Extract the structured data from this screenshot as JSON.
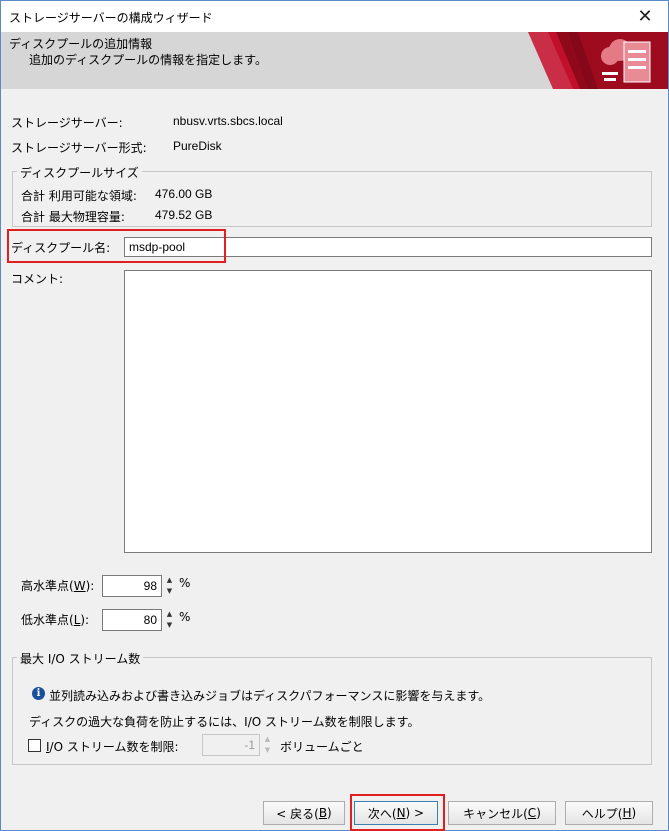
{
  "window": {
    "title": "ストレージサーバーの構成ウィザード",
    "close_glyph": "✕"
  },
  "banner": {
    "title": "ディスクプールの追加情報",
    "subtitle": "追加のディスクプールの情報を指定します。"
  },
  "server": {
    "name_label": "ストレージサーバー:",
    "name_value": "nbusv.vrts.sbcs.local",
    "type_label": "ストレージサーバー形式:",
    "type_value": "PureDisk"
  },
  "pool_size": {
    "legend": "ディスクプールサイズ",
    "available_label": "合計 利用可能な領域:",
    "available_value": "476.00 GB",
    "physical_label": "合計 最大物理容量:",
    "physical_value": "479.52 GB"
  },
  "pool_name": {
    "label": "ディスクプール名:",
    "value": "msdp-pool"
  },
  "comment": {
    "label": "コメント:",
    "value": ""
  },
  "high_water": {
    "label": "高水準点(",
    "mnemonic": "W",
    "label_end": "):",
    "value": "98",
    "unit": "%"
  },
  "low_water": {
    "label": "低水準点(",
    "mnemonic": "L",
    "label_end": "):",
    "value": "80",
    "unit": "%"
  },
  "io_streams": {
    "legend": "最大 I/O ストリーム数",
    "info_text": "並列読み込みおよび書き込みジョブはディスクパフォーマンスに影響を与えます。",
    "warning_text": "ディスクの過大な負荷を防止するには、I/O ストリーム数を制限します。",
    "checkbox_mnemonic": "I",
    "checkbox_label": "/O ストリーム数を制限:",
    "limit_value": "-1",
    "per_volume": "ボリュームごと"
  },
  "buttons": {
    "back": {
      "label": "< 戻る(",
      "mnemonic": "B",
      "end": ")"
    },
    "next": {
      "label": "次へ(",
      "mnemonic": "N",
      "end": ") >"
    },
    "cancel": {
      "label": "キャンセル(",
      "mnemonic": "C",
      "end": ")"
    },
    "help": {
      "label": "ヘルプ(",
      "mnemonic": "H",
      "end": ")"
    }
  },
  "colors": {
    "banner_accent": "#c8102e",
    "highlight": "#e02020"
  }
}
